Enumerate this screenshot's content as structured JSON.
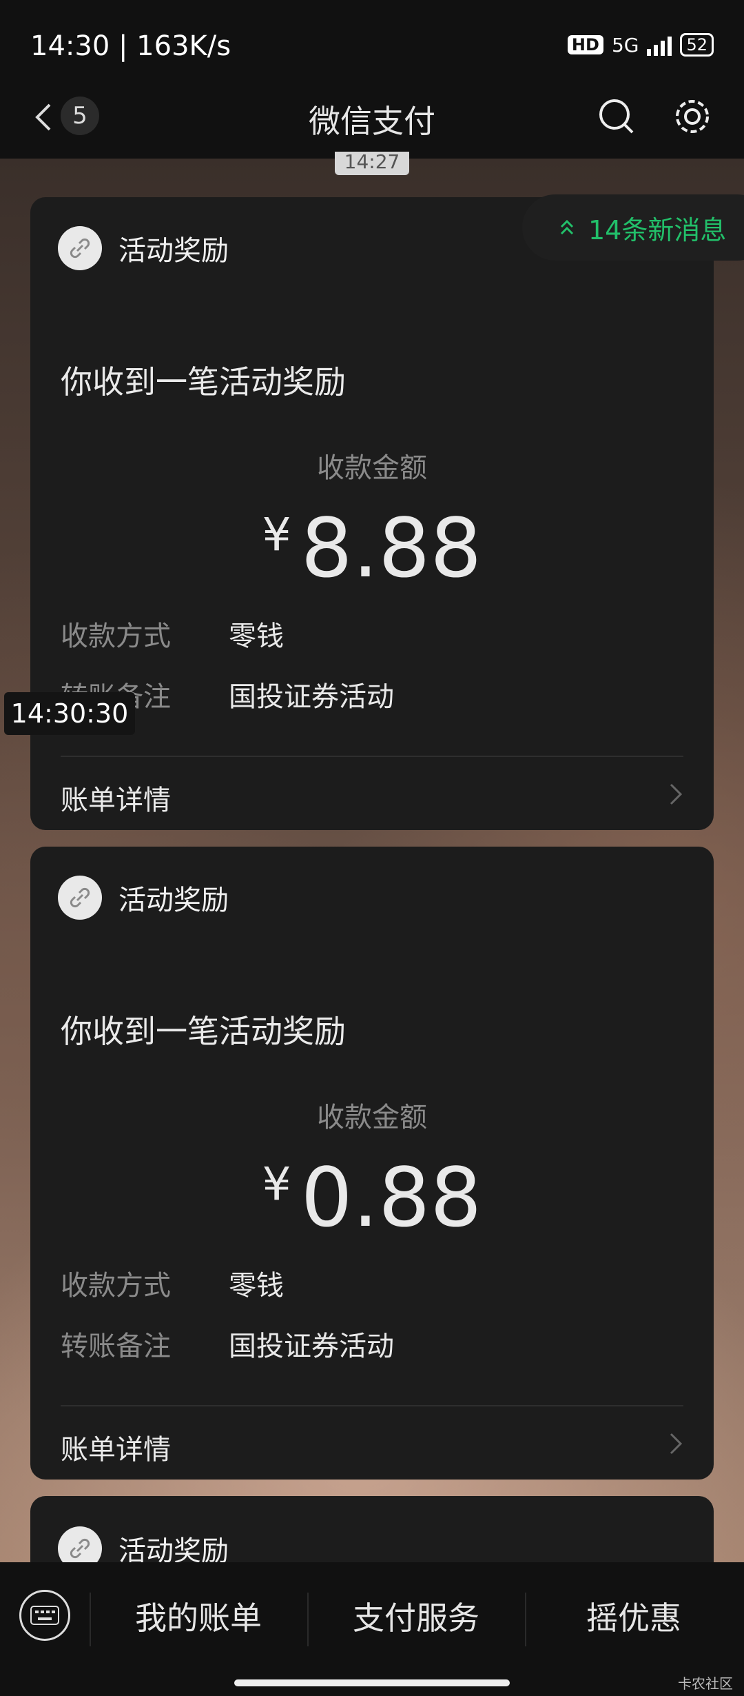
{
  "status": {
    "time_speed": "14:30 | 163K/s",
    "hd": "HD",
    "network": "5G",
    "battery": "52"
  },
  "header": {
    "back_count": "5",
    "title": "微信支付"
  },
  "timestamp_top": "14:27",
  "new_messages": "14条新消息",
  "overlay_time": "14:30:30",
  "cards": [
    {
      "title": "活动奖励",
      "message": "你收到一笔活动奖励",
      "amount_label": "收款金额",
      "currency": "¥",
      "amount": "8.88",
      "method_label": "收款方式",
      "method_value": "零钱",
      "note_label": "转账备注",
      "note_value": "国投证券活动",
      "detail_label": "账单详情"
    },
    {
      "title": "活动奖励",
      "message": "你收到一笔活动奖励",
      "amount_label": "收款金额",
      "currency": "¥",
      "amount": "0.88",
      "method_label": "收款方式",
      "method_value": "零钱",
      "note_label": "转账备注",
      "note_value": "国投证券活动",
      "detail_label": "账单详情"
    },
    {
      "title": "活动奖励"
    }
  ],
  "bottom_menu": [
    "我的账单",
    "支付服务",
    "摇优惠"
  ],
  "watermark": "卡农社区",
  "colors": {
    "accent_green": "#22c06a",
    "card_bg": "#1c1c1c"
  }
}
